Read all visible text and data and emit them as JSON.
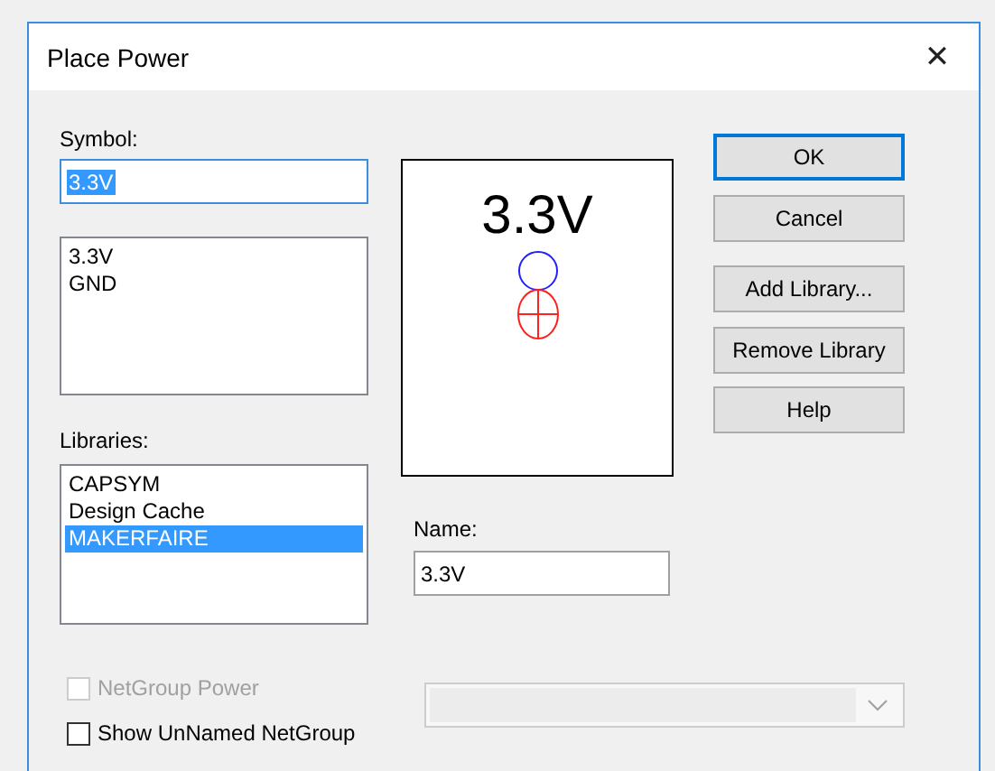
{
  "window": {
    "title": "Place Power",
    "close": "✕"
  },
  "symbol": {
    "label": "Symbol:",
    "value": "3.3V"
  },
  "symbols": [
    {
      "label": "3.3V",
      "selected": false
    },
    {
      "label": "GND",
      "selected": false
    }
  ],
  "libraries_label": "Libraries:",
  "libraries": [
    {
      "label": "CAPSYM",
      "selected": false
    },
    {
      "label": "Design Cache",
      "selected": false
    },
    {
      "label": "MAKERFAIRE",
      "selected": true
    }
  ],
  "preview": {
    "text": "3.3V"
  },
  "name": {
    "label": "Name:",
    "value": "3.3V"
  },
  "buttons": [
    {
      "label": "OK",
      "default": true
    },
    {
      "label": "Cancel",
      "default": false
    },
    {
      "label": "Add Library...",
      "default": false
    },
    {
      "label": "Remove Library",
      "default": false
    },
    {
      "label": "Help",
      "default": false
    }
  ],
  "checkboxes": [
    {
      "label": "NetGroup Power",
      "checked": false,
      "disabled": true
    },
    {
      "label": "Show UnNamed NetGroup",
      "checked": false,
      "disabled": false
    }
  ],
  "netgroup_dropdown": {
    "disabled": true
  }
}
